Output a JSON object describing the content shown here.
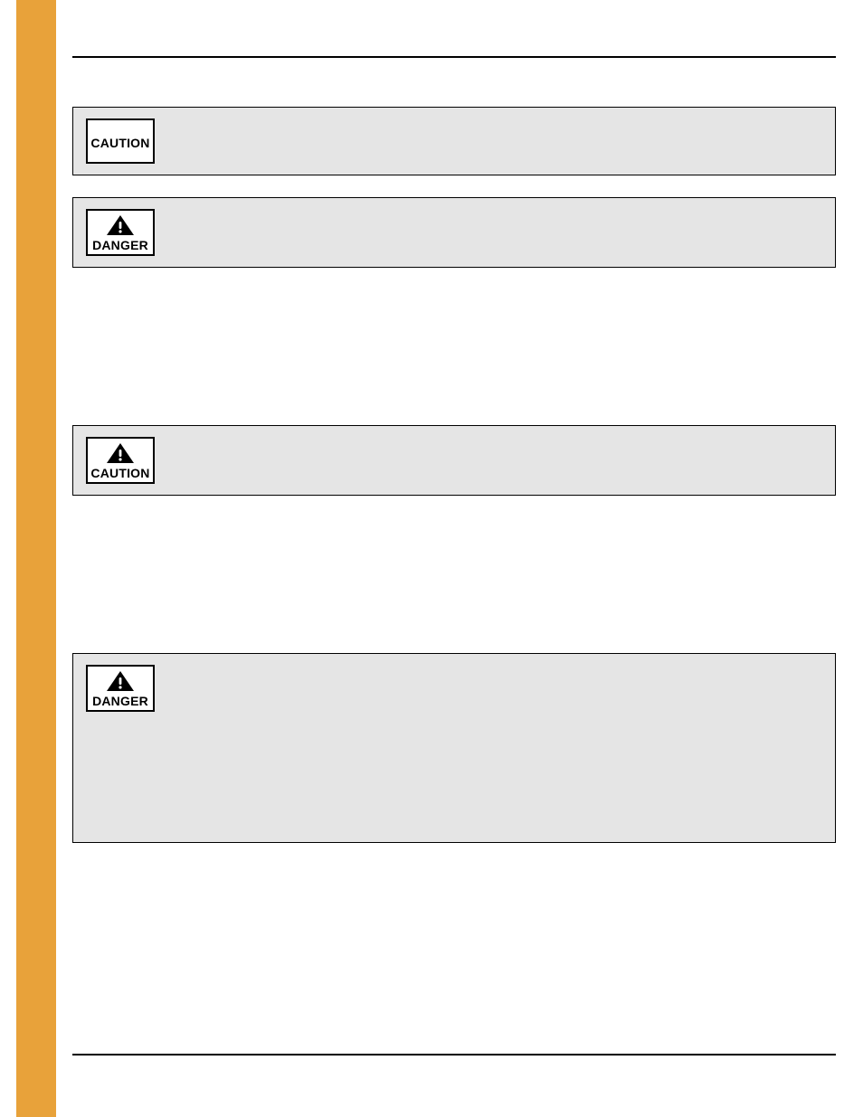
{
  "warning_labels": {
    "caution": "CAUTION",
    "danger": "DANGER"
  },
  "boxes": [
    {
      "type": "caution_plain"
    },
    {
      "type": "danger"
    },
    {
      "type": "caution_icon"
    },
    {
      "type": "danger_tall"
    }
  ]
}
